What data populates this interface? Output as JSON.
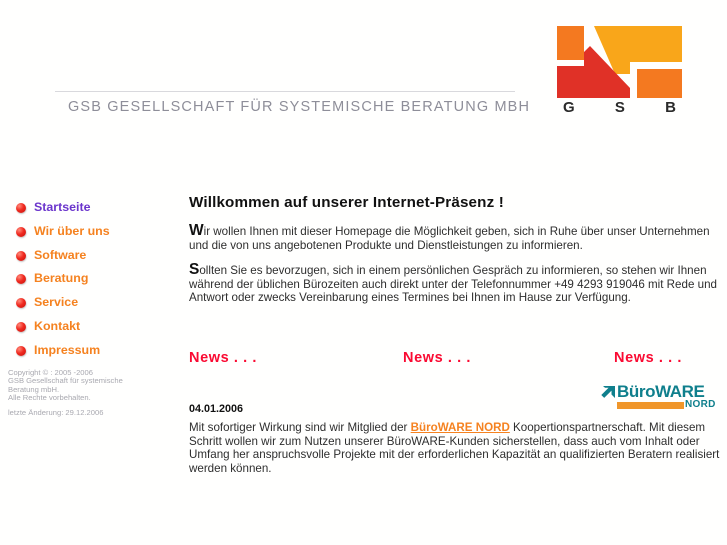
{
  "header": {
    "company_name": "GSB GESELLSCHAFT FÜR SYSTEMISCHE BERATUNG MBH",
    "logo": {
      "name": "gsb-logo",
      "letters": [
        "G",
        "S",
        "B"
      ],
      "colors": {
        "orange": "#f47920",
        "amber": "#f9a61a",
        "red": "#e03127"
      }
    }
  },
  "sidebar": {
    "items": [
      {
        "label": "Startseite",
        "icon": "red-sphere-bullet-icon",
        "active": true
      },
      {
        "label": "Wir über uns",
        "icon": "red-sphere-bullet-icon",
        "active": false
      },
      {
        "label": "Software",
        "icon": "red-sphere-bullet-icon",
        "active": false
      },
      {
        "label": "Beratung",
        "icon": "red-sphere-bullet-icon",
        "active": false
      },
      {
        "label": "Service",
        "icon": "red-sphere-bullet-icon",
        "active": false
      },
      {
        "label": "Kontakt",
        "icon": "red-sphere-bullet-icon",
        "active": false
      },
      {
        "label": "Impressum",
        "icon": "red-sphere-bullet-icon",
        "active": false
      }
    ],
    "active_color": "#6b35cc",
    "link_color": "#f58220"
  },
  "copyright": {
    "line1": "Copyright © : 2005 -2006",
    "line2": "GSB Gesellschaft für systemische",
    "line3": "Beratung mbH.",
    "line4": "Alle Rechte vorbehalten.",
    "line5": "letzte Änderung: 29.12.2006"
  },
  "main": {
    "heading": "Willkommen auf unserer Internet-Präsenz !",
    "paragraph1": {
      "cap": "W",
      "rest": "ir wollen Ihnen mit dieser Homepage die Möglichkeit geben, sich in Ruhe über unser Unternehmen und die von uns angebotenen Produkte und Dienstleistungen zu informieren."
    },
    "paragraph2": {
      "cap": "S",
      "rest": "ollten Sie es bevorzugen, sich in einem persönlichen Gespräch zu informieren, so stehen wir Ihnen während der üblichen Bürozeiten auch direkt unter der Telefonnummer +49 4293 919046 mit Rede und Antwort oder zwecks Vereinbarung eines Termines bei Ihnen im Hause zur Verfügung."
    }
  },
  "news": {
    "titles": [
      "News . . .",
      "News . . .",
      "News . . ."
    ],
    "title_color": "#fa0a32",
    "partner_logo": {
      "name": "bueroware-nord-logo",
      "word_part1": "Büro",
      "word_part2": "WARE",
      "subtitle": "NORD",
      "teal": "#0f7f8c",
      "orange": "#f0962a"
    },
    "entry": {
      "date": "04.01.2006",
      "text_before": "Mit sofortiger Wirkung sind wir Mitglied der ",
      "link": "BüroWARE NORD",
      "text_after": " Koopertionspartnerschaft. Mit diesem Schritt wollen wir zum Nutzen unserer BüroWARE-Kunden sicherstellen, dass auch vom Inhalt oder Umfang her anspruchsvolle Projekte mit der erforderlichen Kapazität an qualifizierten Beratern realisiert werden können."
    }
  }
}
